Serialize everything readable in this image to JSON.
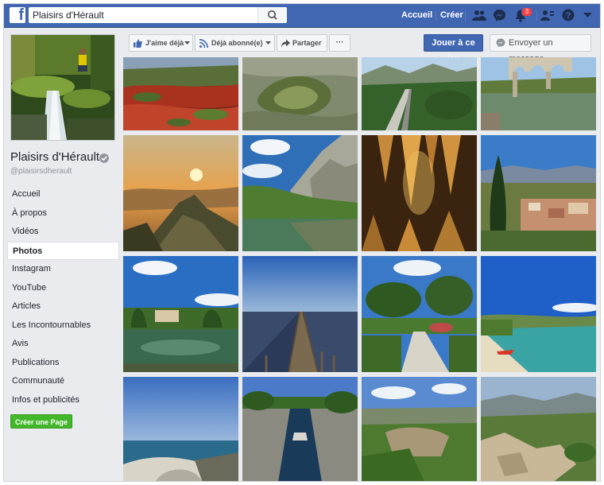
{
  "header": {
    "logo_letter": "f",
    "search_value": "Plaisirs d'Hérault",
    "nav_home": "Accueil",
    "nav_create": "Créer",
    "notification_count": "3",
    "icons": [
      "friends-icon",
      "messenger-icon",
      "notifications-icon",
      "quick-help-icon",
      "help-icon",
      "dropdown-icon"
    ]
  },
  "page": {
    "name": "Plaisirs d'Hérault",
    "handle": "@plaisirsdherault"
  },
  "sidebar": {
    "items": [
      {
        "label": "Accueil",
        "active": false
      },
      {
        "label": "À propos",
        "active": false
      },
      {
        "label": "Vidéos",
        "active": false
      },
      {
        "label": "Photos",
        "active": true
      },
      {
        "label": "Instagram",
        "active": false
      },
      {
        "label": "YouTube",
        "active": false
      },
      {
        "label": "Articles",
        "active": false
      },
      {
        "label": "Les Incontournables",
        "active": false
      },
      {
        "label": "Avis",
        "active": false
      },
      {
        "label": "Publications",
        "active": false
      },
      {
        "label": "Communauté",
        "active": false
      },
      {
        "label": "Infos et publicités",
        "active": false
      }
    ],
    "create_page": "Créer une Page"
  },
  "actions": {
    "like": "J'aime déjà",
    "follow": "Déjà abonné(e)",
    "share": "Partager",
    "more": "···",
    "play": "Jouer à ce jeu",
    "message": "Envoyer un message"
  },
  "photos": [
    {
      "subject": "red-earth-landscape"
    },
    {
      "subject": "aerial-valley"
    },
    {
      "subject": "river-canyon-road"
    },
    {
      "subject": "stone-bridge-river"
    },
    {
      "subject": "sunset-mountain"
    },
    {
      "subject": "lake-cliffs"
    },
    {
      "subject": "cave-stalactites"
    },
    {
      "subject": "village-cypress"
    },
    {
      "subject": "pond-trees"
    },
    {
      "subject": "wooden-jetty"
    },
    {
      "subject": "garden-path"
    },
    {
      "subject": "lake-beach"
    },
    {
      "subject": "sea-coast"
    },
    {
      "subject": "canal-lock"
    },
    {
      "subject": "canyon-cliffs"
    },
    {
      "subject": "rocky-hills"
    }
  ],
  "colors": {
    "brand": "#4267b2",
    "page_bg": "#e9ebee",
    "create_green": "#42b72a",
    "badge_red": "#fa3e3e"
  }
}
